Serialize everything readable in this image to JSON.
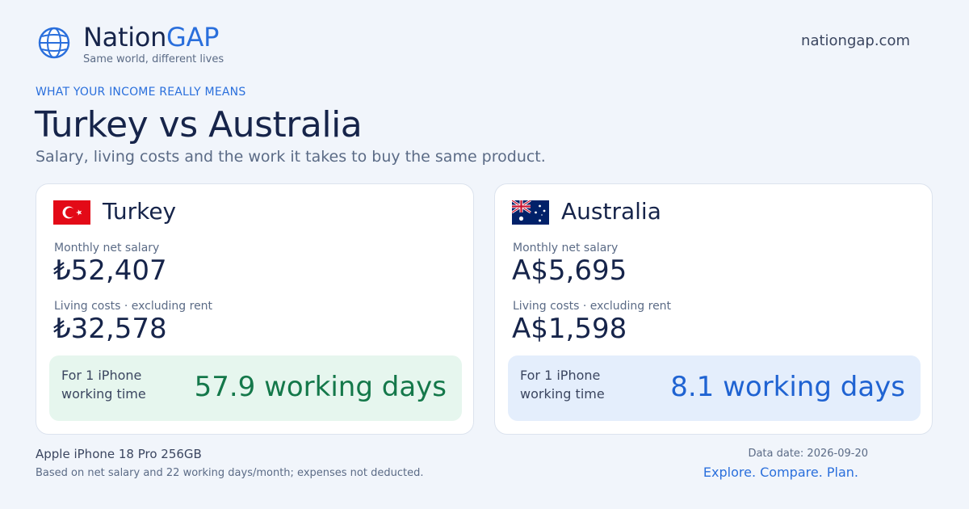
{
  "brand": {
    "name_part1": "Nation",
    "name_part2": "GAP",
    "tagline": "Same world, different lives",
    "domain": "nationgap.com"
  },
  "header": {
    "eyebrow": "WHAT YOUR INCOME REALLY MEANS",
    "title": "Turkey vs Australia",
    "subtitle": "Salary, living costs and the work it takes to buy the same product."
  },
  "cards": [
    {
      "country": "Turkey",
      "flag_icon": "turkey-flag-icon",
      "salary_label": "Monthly net salary",
      "salary_value": "₺52,407",
      "costs_label": "Living costs · excluding rent",
      "costs_value": "₺32,578",
      "work_label": "For 1 iPhone working time",
      "work_value": "57.9 working days",
      "accent": "#14784a"
    },
    {
      "country": "Australia",
      "flag_icon": "australia-flag-icon",
      "salary_label": "Monthly net salary",
      "salary_value": "A$5,695",
      "costs_label": "Living costs · excluding rent",
      "costs_value": "A$1,598",
      "work_label": "For 1 iPhone working time",
      "work_value": "8.1 working days",
      "accent": "#1f63d2"
    }
  ],
  "footer": {
    "product": "Apple iPhone 18 Pro 256GB",
    "basis": "Based on net salary and 22 working days/month; expenses not deducted.",
    "data_date": "Data date: 2026-09-20",
    "cta": "Explore. Compare. Plan."
  },
  "colors": {
    "brand_accent": "#2a6fdc",
    "background": "#f1f5fb",
    "text": "#16244a"
  }
}
